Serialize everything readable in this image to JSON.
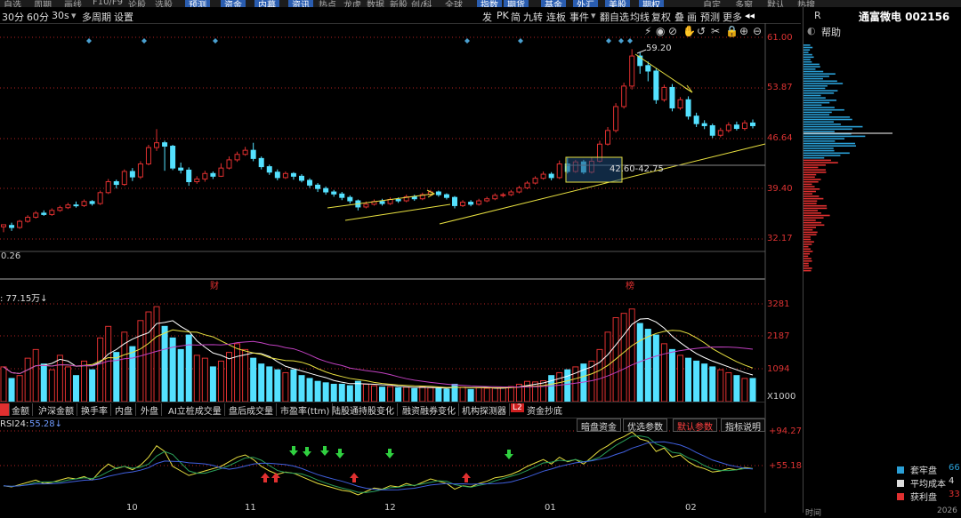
{
  "top_menu": [
    "自选",
    "周期",
    "画线",
    "F10/F9",
    "论股",
    "选股",
    "预测",
    "资金",
    "内幕",
    "资讯",
    "热点",
    "龙虎",
    "数据",
    "新股",
    "创/科",
    "全球",
    "指数",
    "期货",
    "基金",
    "外汇",
    "美股",
    "期权",
    "自定",
    "多窗",
    "默认",
    "热搜"
  ],
  "toolbar": {
    "left": [
      "30分",
      "60分",
      "30s",
      "多周期",
      "设置"
    ],
    "right": [
      "发",
      "PK",
      "简",
      "九转",
      "连板",
      "事件",
      "翻自选",
      "均线",
      "复权",
      "叠",
      "画",
      "预测",
      "更多"
    ]
  },
  "stock": {
    "header_left": "R",
    "name_code": "通富微电 002156",
    "help": "帮助"
  },
  "price_axis": [
    "61.00",
    "53.87",
    "46.64",
    "39.40",
    "32.17"
  ],
  "annotations": {
    "peak": "59.20",
    "box_range": "42.60-42.75",
    "left_value": "0.26",
    "cai": "财",
    "bang": "榜"
  },
  "volume": {
    "title": ": 77.15万↓",
    "axis": [
      "3281",
      "2187",
      "1094",
      "X1000"
    ]
  },
  "indicator_tabs": [
    "金额",
    "沪深金额",
    "换手率",
    "内盘",
    "外盘",
    "AI立桩成交量",
    "盘后成交量",
    "市盈率(ttm)",
    "陆股通持股变化",
    "融资融券变化",
    "机构探测器",
    "资金抄底"
  ],
  "panel_tabs": [
    "暗盘资金",
    "优选参数",
    "默认参数",
    "指标说明"
  ],
  "rsi": {
    "title": "RSI24: ",
    "value": "55.28↓",
    "axis": [
      "+94.27",
      "+55.18"
    ]
  },
  "x_axis": [
    "10",
    "11",
    "12",
    "01",
    "02"
  ],
  "chip_legend": [
    {
      "label": "套牢盘",
      "value": "66",
      "color": "#2a9fd6"
    },
    {
      "label": "平均成本",
      "value": "4",
      "color": "#dddddd"
    },
    {
      "label": "获利盘",
      "value": "33",
      "color": "#e03030"
    }
  ],
  "bottom_right": [
    "时间",
    "2026"
  ],
  "colors": {
    "up": "#e03030",
    "down": "#54e1ff",
    "grid": "#b22222"
  },
  "chart_data": {
    "type": "candlestick",
    "price_ylim": [
      30.5,
      62.5
    ],
    "candles": [
      [
        33.2,
        33.5,
        32.4,
        33.4
      ],
      [
        33.4,
        33.1,
        32.6,
        33.8
      ],
      [
        33.1,
        34.0,
        32.9,
        34.2
      ],
      [
        34.0,
        34.6,
        33.8,
        34.9
      ],
      [
        34.6,
        35.2,
        34.4,
        35.5
      ],
      [
        35.2,
        35.0,
        34.8,
        35.6
      ],
      [
        35.0,
        35.6,
        34.8,
        35.9
      ],
      [
        35.6,
        36.0,
        35.4,
        36.3
      ],
      [
        36.0,
        36.4,
        35.8,
        36.7
      ],
      [
        36.4,
        36.3,
        36.0,
        36.9
      ],
      [
        36.3,
        36.9,
        36.1,
        37.2
      ],
      [
        36.9,
        36.6,
        36.3,
        37.1
      ],
      [
        36.6,
        38.2,
        36.4,
        38.5
      ],
      [
        38.2,
        39.8,
        38.0,
        40.2
      ],
      [
        39.8,
        39.4,
        38.8,
        40.1
      ],
      [
        39.4,
        41.3,
        39.2,
        41.6
      ],
      [
        41.3,
        40.5,
        39.9,
        41.8
      ],
      [
        40.5,
        42.4,
        40.2,
        42.8
      ],
      [
        42.4,
        44.8,
        42.2,
        45.2
      ],
      [
        44.8,
        45.5,
        44.3,
        47.5
      ],
      [
        45.5,
        45.0,
        41.4,
        45.8
      ],
      [
        45.0,
        41.8,
        41.5,
        45.2
      ],
      [
        41.8,
        41.5,
        41.0,
        42.6
      ],
      [
        41.5,
        39.8,
        39.2,
        41.9
      ],
      [
        39.8,
        40.2,
        39.5,
        40.6
      ],
      [
        40.2,
        41.0,
        39.8,
        41.4
      ],
      [
        41.0,
        40.6,
        40.2,
        41.3
      ],
      [
        40.6,
        41.8,
        40.5,
        42.5
      ],
      [
        41.8,
        43.0,
        41.6,
        43.5
      ],
      [
        43.0,
        43.8,
        42.7,
        44.2
      ],
      [
        43.8,
        44.4,
        43.6,
        44.9
      ],
      [
        44.4,
        43.2,
        42.8,
        45.5
      ],
      [
        43.2,
        42.0,
        41.6,
        43.5
      ],
      [
        42.0,
        41.2,
        40.8,
        42.3
      ],
      [
        41.2,
        40.4,
        40.0,
        41.6
      ],
      [
        40.4,
        41.0,
        40.2,
        41.3
      ],
      [
        41.0,
        40.6,
        40.1,
        41.2
      ],
      [
        40.6,
        40.0,
        39.7,
        40.9
      ],
      [
        40.0,
        39.3,
        38.9,
        40.3
      ],
      [
        39.3,
        38.8,
        38.3,
        39.6
      ],
      [
        38.8,
        38.3,
        37.9,
        39.1
      ],
      [
        38.3,
        38.0,
        37.6,
        38.6
      ],
      [
        38.0,
        37.5,
        37.1,
        38.3
      ],
      [
        37.5,
        37.0,
        36.6,
        37.8
      ],
      [
        37.0,
        36.1,
        35.6,
        37.2
      ],
      [
        36.1,
        36.5,
        35.9,
        36.9
      ],
      [
        36.5,
        36.9,
        36.3,
        37.2
      ],
      [
        36.9,
        36.6,
        36.3,
        37.3
      ],
      [
        36.6,
        37.2,
        36.4,
        37.5
      ],
      [
        37.2,
        37.0,
        36.7,
        37.5
      ],
      [
        37.0,
        37.6,
        36.8,
        37.9
      ],
      [
        37.6,
        37.3,
        37.0,
        37.9
      ],
      [
        37.3,
        37.9,
        37.1,
        38.2
      ],
      [
        37.9,
        38.3,
        37.7,
        38.6
      ],
      [
        38.3,
        37.9,
        37.6,
        38.5
      ],
      [
        37.9,
        37.5,
        37.2,
        38.1
      ],
      [
        37.5,
        36.3,
        35.9,
        37.7
      ],
      [
        36.3,
        36.8,
        36.1,
        37.1
      ],
      [
        36.8,
        36.5,
        36.2,
        37.1
      ],
      [
        36.5,
        37.0,
        36.3,
        37.3
      ],
      [
        37.0,
        37.3,
        36.8,
        37.6
      ],
      [
        37.3,
        37.8,
        37.1,
        38.1
      ],
      [
        37.8,
        37.9,
        37.5,
        38.2
      ],
      [
        37.9,
        38.3,
        37.7,
        38.6
      ],
      [
        38.3,
        38.9,
        38.1,
        39.2
      ],
      [
        38.9,
        39.6,
        38.7,
        39.9
      ],
      [
        39.6,
        40.3,
        39.4,
        40.6
      ],
      [
        40.3,
        40.9,
        40.1,
        41.3
      ],
      [
        40.9,
        40.4,
        40.0,
        41.2
      ],
      [
        40.4,
        42.4,
        40.2,
        42.9
      ],
      [
        42.4,
        41.3,
        41.0,
        43.3
      ],
      [
        41.3,
        42.7,
        41.1,
        43.0
      ],
      [
        42.7,
        41.2,
        40.9,
        43.0
      ],
      [
        41.2,
        42.8,
        41.0,
        43.4
      ],
      [
        42.8,
        45.3,
        42.6,
        45.8
      ],
      [
        45.3,
        47.3,
        45.1,
        47.8
      ],
      [
        47.3,
        50.8,
        47.0,
        51.3
      ],
      [
        50.8,
        53.8,
        50.5,
        54.3
      ],
      [
        53.8,
        58.2,
        53.3,
        59.2
      ],
      [
        58.2,
        56.8,
        55.6,
        58.7
      ],
      [
        56.8,
        56.0,
        54.5,
        57.4
      ],
      [
        56.0,
        51.8,
        51.2,
        56.4
      ],
      [
        51.8,
        53.6,
        51.5,
        54.0
      ],
      [
        53.6,
        50.6,
        50.1,
        54.1
      ],
      [
        50.6,
        51.8,
        50.3,
        52.2
      ],
      [
        51.8,
        49.4,
        48.9,
        52.3
      ],
      [
        49.4,
        48.3,
        47.8,
        49.9
      ],
      [
        48.3,
        48.0,
        47.5,
        48.8
      ],
      [
        48.0,
        46.6,
        46.2,
        48.3
      ],
      [
        46.6,
        47.3,
        46.3,
        47.7
      ],
      [
        47.3,
        48.1,
        47.0,
        48.5
      ],
      [
        48.1,
        47.6,
        47.3,
        48.6
      ],
      [
        47.6,
        48.4,
        47.3,
        48.8
      ],
      [
        48.4,
        48.0,
        47.6,
        48.9
      ]
    ],
    "volume_ylim": [
      0,
      3500
    ],
    "volume": [
      1200,
      800,
      900,
      1500,
      1800,
      1300,
      1100,
      1600,
      1200,
      900,
      1400,
      1100,
      2200,
      2600,
      1700,
      2400,
      1900,
      2800,
      3100,
      3281,
      2600,
      2200,
      1800,
      2300,
      1600,
      1500,
      1200,
      1400,
      1700,
      2000,
      1800,
      1500,
      1300,
      1200,
      1100,
      1000,
      1100,
      900,
      800,
      700,
      650,
      600,
      600,
      550,
      700,
      600,
      550,
      500,
      520,
      480,
      500,
      450,
      520,
      480,
      450,
      430,
      600,
      500,
      420,
      480,
      460,
      470,
      500,
      520,
      600,
      700,
      680,
      720,
      900,
      1000,
      1100,
      1200,
      1300,
      1400,
      1800,
      2400,
      2900,
      3050,
      3200,
      2700,
      2500,
      2300,
      2000,
      1800,
      1600,
      1500,
      1400,
      1300,
      1200,
      1100,
      1000,
      900,
      800,
      800
    ],
    "rsi_ylim": [
      30,
      100
    ],
    "rsi": [
      45,
      44,
      46,
      48,
      50,
      47,
      48,
      50,
      52,
      51,
      53,
      50,
      58,
      64,
      60,
      62,
      59,
      63,
      70,
      80,
      75,
      62,
      58,
      54,
      56,
      58,
      60,
      62,
      66,
      70,
      72,
      68,
      62,
      58,
      55,
      57,
      56,
      53,
      50,
      47,
      45,
      43,
      41,
      40,
      37,
      40,
      43,
      42,
      45,
      44,
      47,
      45,
      48,
      51,
      49,
      47,
      42,
      45,
      44,
      47,
      49,
      52,
      53,
      55,
      58,
      62,
      65,
      68,
      64,
      70,
      66,
      68,
      64,
      70,
      76,
      80,
      85,
      88,
      92,
      86,
      84,
      75,
      78,
      70,
      72,
      66,
      62,
      60,
      57,
      58,
      60,
      59,
      61,
      60
    ]
  }
}
